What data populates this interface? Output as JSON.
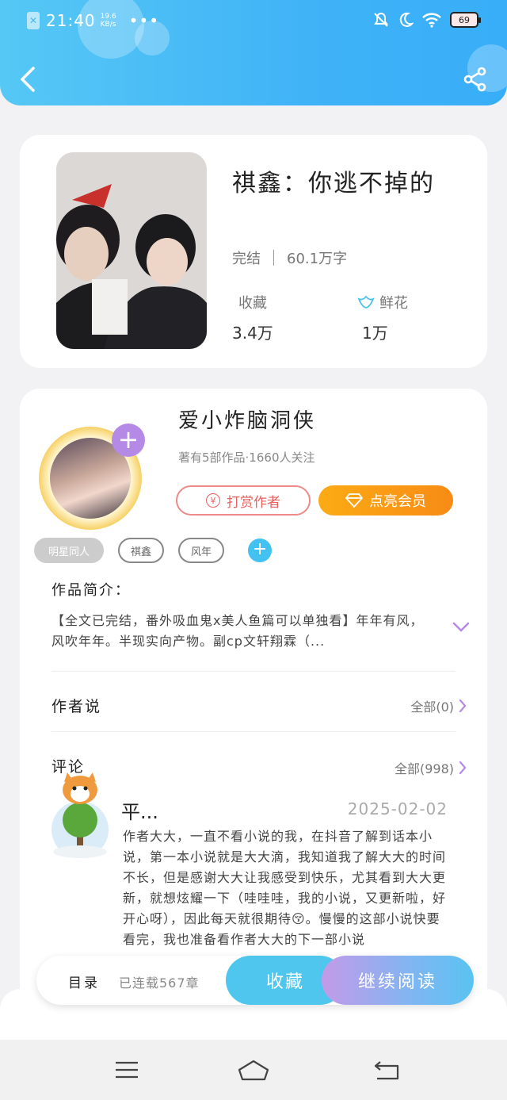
{
  "status_bar": {
    "time": "21:40",
    "speed": "19.6 KB/s",
    "more": "•••",
    "battery": "69"
  },
  "book": {
    "title": "祺鑫：你逃不掉的",
    "status": "完结",
    "word_count": "60.1万字",
    "favorites_label": "收藏",
    "favorites_value": "3.4万",
    "flowers_label": "鲜花",
    "flowers_value": "1万"
  },
  "author": {
    "name": "爱小炸脑洞侠",
    "info": "著有5部作品·1660人关注",
    "tip_label": "打赏作者",
    "tip_icon": "¥",
    "vip_label": "点亮会员"
  },
  "tags": [
    "明星同人",
    "祺鑫",
    "风年"
  ],
  "intro": {
    "title": "作品简介：",
    "text": "【全文已完结，番外吸血鬼x美人鱼篇可以单独看】年年有风，风吹年年。半现实向产物。副cp文轩翔霖（..."
  },
  "author_says": {
    "title": "作者说",
    "all_label": "全部(0)"
  },
  "comments": {
    "title": "评论",
    "all_label": "全部(998)",
    "user": "平...",
    "date": "2025-02-02",
    "text": "作者大大，一直不看小说的我，在抖音了解到话本小说，第一本小说就是大大滴，我知道我了解大大的时间不长，但是感谢大大让我感受到快乐，尤其看到大大更新，就想炫耀一下（哇哇哇，我的小说，又更新啦，好开心呀），因此每天就很期待😚。慢慢的这部小说快要看完，我也准备看作者大大的下一部小说"
  },
  "bottom_bar": {
    "toc_label": "目录",
    "chapters": "已连载567章",
    "favorite_button": "收藏",
    "continue_button": "继续阅读"
  },
  "colors": {
    "header": "#40b3f7",
    "accent_blue": "#4fc6ee",
    "accent_purple": "#b48ae6",
    "orange": "#f88b16",
    "tip_red": "#e5605f"
  }
}
